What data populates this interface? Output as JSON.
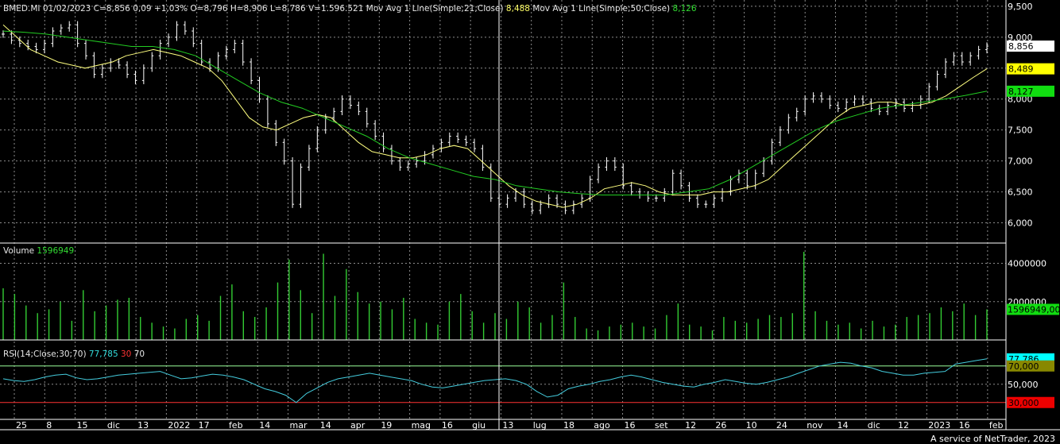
{
  "header": {
    "symbol_line": "BMED.MI 01/02/2023 C=8,856 0,09 +1,03% O=8,796 H=8,906 L=8,786 V=1.596.521",
    "ma21_label": "Mov Avg 1 Line(Simple;21;Close)",
    "ma21_value": "8,488",
    "ma50_label": "Mov Avg 1 Line(Simple;50;Close)",
    "ma50_value": "8,126"
  },
  "volume_panel": {
    "label": "Volume",
    "value": "1596949"
  },
  "rsi_panel": {
    "label": "RSI(14;Close;30;70)",
    "value": "77,785",
    "lower": "30",
    "upper": "70"
  },
  "footer": {
    "credit": "A service of NetTrader, 2023"
  },
  "colors": {
    "background": "#000000",
    "grid": "#8c8c8c",
    "price": "#ffffff",
    "ma21": "#ffff80",
    "ma50": "#22cc22",
    "volume": "#33cc33",
    "rsi": "#44ccdd",
    "rsi_upper": "#99ff99",
    "rsi_lower": "#ff3333"
  },
  "chart_data": [
    {
      "type": "line",
      "title": "BMED.MI",
      "ylim": [
        5.75,
        9.55
      ],
      "y_ticks": [
        "9,500",
        "9,000",
        "8,500",
        "8,000",
        "7,500",
        "7,000",
        "6,500",
        "6,000"
      ],
      "x_ticks": [
        "25",
        "8",
        "15",
        "dic",
        "13",
        "2022",
        "17",
        "feb",
        "14",
        "mar",
        "14",
        "apr",
        "19",
        "mag",
        "16",
        "giu",
        "13",
        "lug",
        "18",
        "ago",
        "16",
        "set",
        "12",
        "26",
        "10",
        "24",
        "nov",
        "14",
        "dic",
        "12",
        "2023",
        "16",
        "feb"
      ],
      "series": [
        {
          "name": "Close",
          "values": [
            9.05,
            8.95,
            8.9,
            8.85,
            8.8,
            8.9,
            9.1,
            9.15,
            9.2,
            8.9,
            8.7,
            8.4,
            8.5,
            8.6,
            8.55,
            8.4,
            8.3,
            8.5,
            8.7,
            8.9,
            9.0,
            9.2,
            9.1,
            8.9,
            8.6,
            8.5,
            8.7,
            8.8,
            8.9,
            8.6,
            8.3,
            8.0,
            7.6,
            7.3,
            7.0,
            6.3,
            6.9,
            7.2,
            7.5,
            7.7,
            7.8,
            8.0,
            7.9,
            7.8,
            7.6,
            7.4,
            7.2,
            7.0,
            6.9,
            6.95,
            7.0,
            7.1,
            7.2,
            7.3,
            7.4,
            7.35,
            7.3,
            7.2,
            6.9,
            6.4,
            6.3,
            6.4,
            6.5,
            6.3,
            6.2,
            6.3,
            6.4,
            6.3,
            6.2,
            6.3,
            6.4,
            6.7,
            6.9,
            7.0,
            6.9,
            6.6,
            6.5,
            6.45,
            6.4,
            6.4,
            6.5,
            6.8,
            6.6,
            6.4,
            6.3,
            6.3,
            6.4,
            6.5,
            6.7,
            6.8,
            6.6,
            6.8,
            7.0,
            7.3,
            7.5,
            7.7,
            7.8,
            8.0,
            8.05,
            8.0,
            7.9,
            7.85,
            7.95,
            8.0,
            7.95,
            7.85,
            7.8,
            7.9,
            7.95,
            7.85,
            7.9,
            8.0,
            8.2,
            8.4,
            8.6,
            8.7,
            8.6,
            8.7,
            8.8,
            8.856
          ]
        },
        {
          "name": "Mov Avg 1 Line(Simple;21;Close)",
          "values": [
            9.2,
            9.0,
            8.8,
            8.7,
            8.6,
            8.55,
            8.5,
            8.55,
            8.6,
            8.7,
            8.75,
            8.8,
            8.75,
            8.7,
            8.6,
            8.5,
            8.3,
            8.0,
            7.7,
            7.55,
            7.5,
            7.6,
            7.7,
            7.75,
            7.7,
            7.5,
            7.3,
            7.15,
            7.1,
            7.05,
            7.05,
            7.1,
            7.2,
            7.25,
            7.2,
            7.0,
            6.8,
            6.6,
            6.45,
            6.35,
            6.3,
            6.25,
            6.3,
            6.4,
            6.55,
            6.6,
            6.65,
            6.6,
            6.5,
            6.45,
            6.45,
            6.45,
            6.5,
            6.5,
            6.55,
            6.6,
            6.7,
            6.9,
            7.1,
            7.3,
            7.5,
            7.7,
            7.85,
            7.9,
            7.95,
            7.95,
            7.9,
            7.9,
            7.95,
            8.05,
            8.2,
            8.35,
            8.489
          ]
        },
        {
          "name": "Mov Avg 1 Line(Simple;50;Close)",
          "values": [
            9.1,
            9.08,
            9.05,
            9.0,
            8.95,
            8.9,
            8.85,
            8.85,
            8.8,
            8.7,
            8.5,
            8.3,
            8.1,
            7.95,
            7.85,
            7.7,
            7.55,
            7.4,
            7.2,
            7.05,
            6.95,
            6.85,
            6.75,
            6.7,
            6.6,
            6.55,
            6.5,
            6.47,
            6.45,
            6.45,
            6.45,
            6.45,
            6.5,
            6.55,
            6.7,
            6.9,
            7.1,
            7.3,
            7.5,
            7.65,
            7.75,
            7.85,
            7.9,
            7.95,
            8.0,
            8.06,
            8.127
          ]
        }
      ],
      "last_labels": [
        "8,856",
        "8,489",
        "8,127"
      ]
    },
    {
      "type": "bar",
      "title": "Volume",
      "ylim": [
        0,
        5100000
      ],
      "y_ticks": [
        "4000000",
        "2000000"
      ],
      "series": [
        {
          "name": "Volume",
          "values": [
            2700000,
            2400000,
            1800000,
            1400000,
            1600000,
            2000000,
            1000000,
            2600000,
            1500000,
            1800000,
            2100000,
            2200000,
            1200000,
            900000,
            700000,
            600000,
            1100000,
            1300000,
            1000000,
            2300000,
            2900000,
            1500000,
            1200000,
            1700000,
            3000000,
            4200000,
            2600000,
            1400000,
            4500000,
            2300000,
            3700000,
            2500000,
            1900000,
            2000000,
            1600000,
            2200000,
            1100000,
            900000,
            800000,
            2000000,
            2400000,
            1500000,
            900000,
            1400000,
            1100000,
            2000000,
            1700000,
            900000,
            1300000,
            3000000,
            1200000,
            600000,
            500000,
            700000,
            800000,
            900000,
            700000,
            600000,
            1300000,
            1900000,
            800000,
            700000,
            500000,
            1200000,
            1000000,
            900000,
            1100000,
            1300000,
            1200000,
            1400000,
            4600000,
            1500000,
            1000000,
            800000,
            900000,
            600000,
            1000000,
            700000,
            800000,
            1200000,
            1300000,
            1400000,
            1700000,
            1500000,
            1900000,
            1300000,
            1596949
          ]
        }
      ],
      "last_labels": [
        "1596949,00"
      ]
    },
    {
      "type": "line",
      "title": "RSI(14;Close;30;70)",
      "ylim": [
        15,
        95
      ],
      "y_ticks": [
        "70,000",
        "50,000",
        "30,000"
      ],
      "series": [
        {
          "name": "RSI",
          "values": [
            56,
            54,
            53,
            55,
            58,
            60,
            61,
            57,
            55,
            56,
            58,
            60,
            61,
            62,
            63,
            64,
            60,
            56,
            57,
            59,
            61,
            60,
            58,
            55,
            50,
            45,
            42,
            38,
            30,
            40,
            46,
            52,
            56,
            58,
            60,
            62,
            60,
            58,
            56,
            54,
            50,
            47,
            46,
            48,
            50,
            52,
            54,
            55,
            56,
            54,
            50,
            42,
            36,
            38,
            45,
            48,
            50,
            53,
            55,
            58,
            60,
            58,
            55,
            52,
            50,
            48,
            47,
            50,
            52,
            55,
            53,
            51,
            50,
            52,
            55,
            58,
            62,
            66,
            70,
            72,
            74,
            73,
            70,
            68,
            64,
            62,
            60,
            60,
            62,
            63,
            64,
            72,
            74,
            76,
            77.785
          ]
        }
      ],
      "last_labels": [
        "77,786",
        "70,000",
        "30,000"
      ]
    }
  ]
}
